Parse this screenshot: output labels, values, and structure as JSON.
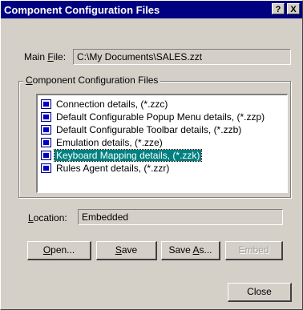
{
  "window": {
    "title": "Component Configuration Files",
    "help_label": "?",
    "close_label": "X"
  },
  "main_file": {
    "label_pre": "Main ",
    "label_accel": "F",
    "label_post": "ile:",
    "value": "C:\\My Documents\\SALES.zzt"
  },
  "group": {
    "title_accel": "C",
    "title_rest": "omponent Configuration Files",
    "icon": "config-file-icon",
    "items": [
      {
        "label": "Connection details, (*.zzc)",
        "selected": false
      },
      {
        "label": "Default Configurable Popup Menu details, (*.zzp)",
        "selected": false
      },
      {
        "label": "Default Configurable Toolbar details, (*.zzb)",
        "selected": false
      },
      {
        "label": "Emulation details, (*.zze)",
        "selected": false
      },
      {
        "label": "Keyboard Mapping details, (*.zzk)",
        "selected": true
      },
      {
        "label": "Rules Agent details, (*.zzr)",
        "selected": false
      }
    ]
  },
  "location": {
    "label_accel": "L",
    "label_rest": "ocation:",
    "value": "Embedded"
  },
  "buttons": {
    "open_accel": "O",
    "open_rest": "pen...",
    "save_accel": "S",
    "save_rest": "ave",
    "saveas_pre": "Save ",
    "saveas_accel": "A",
    "saveas_rest": "s...",
    "embed": "Embed",
    "close": "Close"
  },
  "colors": {
    "titlebar": "#000080",
    "selection": "#008080",
    "face": "#d4d0c8"
  }
}
